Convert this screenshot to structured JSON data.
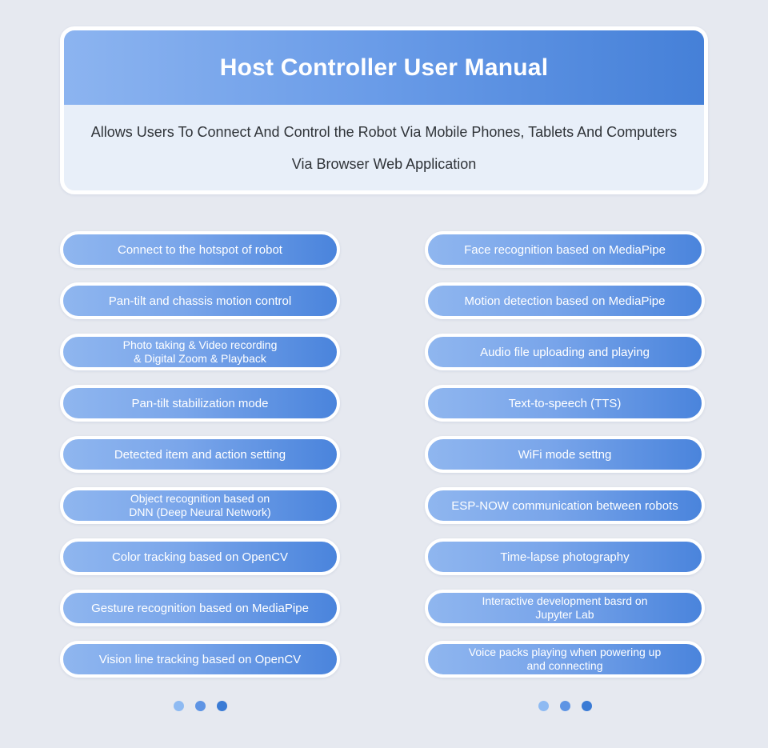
{
  "page": {
    "background_color": "#E6E9F0"
  },
  "header": {
    "title": "Host Controller User Manual",
    "subtitle": "Allows Users To Connect And Control the Robot Via Mobile Phones, Tablets And Computers Via Browser Web Application",
    "banner_gradient_start": "#8CB4F0",
    "banner_gradient_end": "#4580D8",
    "panel_color": "#E8EFF9",
    "title_color": "#FFFFFF",
    "subtitle_color": "#2F3338"
  },
  "features": {
    "pill_gradient_start": "#8FB6EF",
    "pill_gradient_end": "#4A84DC",
    "pill_text_color": "#FFFFFF",
    "left_column": [
      {
        "label": "Connect to the hotspot of robot",
        "lines": 1
      },
      {
        "label": "Pan-tilt and chassis motion control",
        "lines": 1
      },
      {
        "label": "Photo taking & Video recording\n& Digital Zoom & Playback",
        "lines": 2
      },
      {
        "label": "Pan-tilt stabilization mode",
        "lines": 1
      },
      {
        "label": "Detected item and action setting",
        "lines": 1
      },
      {
        "label": "Object recognition based on\nDNN (Deep Neural Network)",
        "lines": 2
      },
      {
        "label": "Color tracking based on OpenCV",
        "lines": 1
      },
      {
        "label": "Gesture recognition based on MediaPipe",
        "lines": 1
      },
      {
        "label": "Vision line tracking based on OpenCV",
        "lines": 1
      }
    ],
    "right_column": [
      {
        "label": "Face recognition based on MediaPipe",
        "lines": 1
      },
      {
        "label": "Motion detection based on MediaPipe",
        "lines": 1
      },
      {
        "label": "Audio file uploading and playing",
        "lines": 1
      },
      {
        "label": "Text-to-speech (TTS)",
        "lines": 1
      },
      {
        "label": "WiFi mode settng",
        "lines": 1
      },
      {
        "label": "ESP-NOW communication between robots",
        "lines": 1
      },
      {
        "label": "Time-lapse photography",
        "lines": 1
      },
      {
        "label": "Interactive development basrd on\nJupyter Lab",
        "lines": 2
      },
      {
        "label": "Voice packs playing when powering up\nand connecting",
        "lines": 2
      }
    ]
  },
  "pagination": {
    "left_dots": [
      {
        "color": "#8EBAF2"
      },
      {
        "color": "#5E94E4"
      },
      {
        "color": "#3A7BD5"
      }
    ],
    "right_dots": [
      {
        "color": "#8EBAF2"
      },
      {
        "color": "#5E94E4"
      },
      {
        "color": "#3A7BD5"
      }
    ]
  }
}
